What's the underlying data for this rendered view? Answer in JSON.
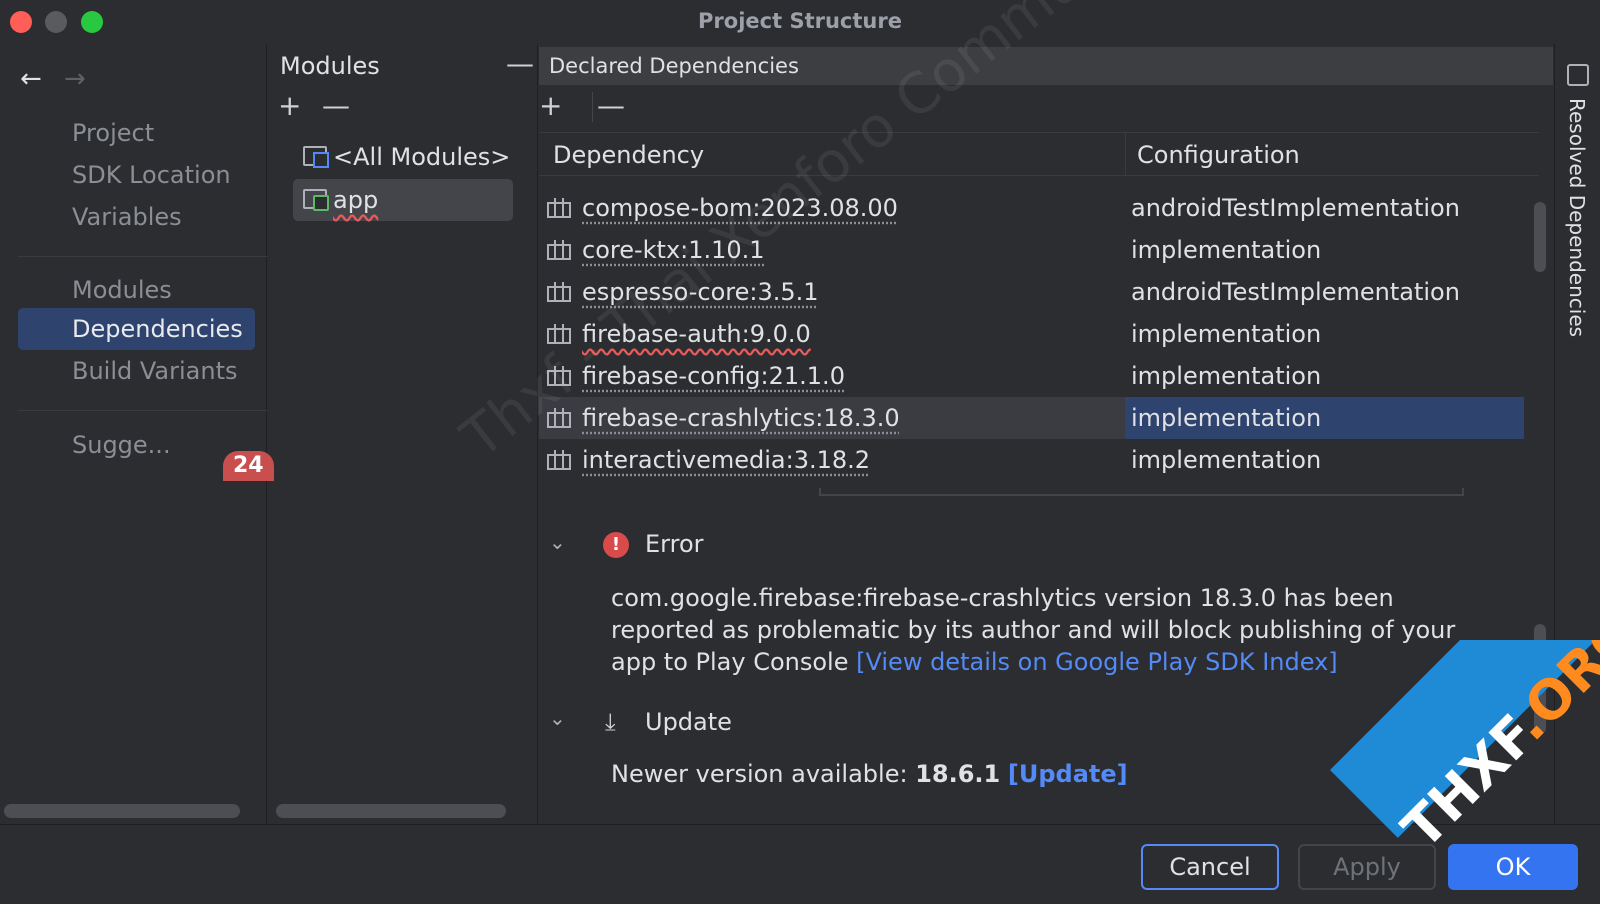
{
  "window": {
    "title": "Project Structure"
  },
  "nav": {
    "back_icon": "←",
    "forward_icon": "→",
    "items": [
      {
        "label": "Project"
      },
      {
        "label": "SDK Location"
      },
      {
        "label": "Variables"
      },
      {
        "label": "Modules"
      },
      {
        "label": "Dependencies",
        "selected": true
      },
      {
        "label": "Build Variants"
      },
      {
        "label": "Sugge..."
      }
    ],
    "suggestions_badge": "24"
  },
  "modules": {
    "title": "Modules",
    "collapse_icon": "—",
    "add_icon": "+",
    "remove_icon": "—",
    "items": [
      {
        "label": "<All Modules>",
        "icon": "all-modules-folder-icon"
      },
      {
        "label": "app",
        "icon": "module-folder-icon",
        "selected": true
      }
    ]
  },
  "declared": {
    "title": "Declared Dependencies",
    "add_icon": "+",
    "remove_icon": "—",
    "columns": {
      "dependency": "Dependency",
      "configuration": "Configuration"
    },
    "rows": [
      {
        "name": "compose-bom:2023.08.00",
        "config": "androidTestImplementation"
      },
      {
        "name": "core-ktx:1.10.1",
        "config": "implementation"
      },
      {
        "name": "espresso-core:3.5.1",
        "config": "androidTestImplementation"
      },
      {
        "name": "firebase-auth:9.0.0",
        "config": "implementation"
      },
      {
        "name": "firebase-config:21.1.0",
        "config": "implementation"
      },
      {
        "name": "firebase-crashlytics:18.3.0",
        "config": "implementation"
      },
      {
        "name": "interactivemedia:3.18.2",
        "config": "implementation"
      }
    ]
  },
  "details": {
    "error": {
      "title": "Error",
      "chevron": "⌄",
      "message": "com.google.firebase:firebase-crashlytics version 18.3.0 has been reported as problematic by its author and will block publishing of your app to Play Console",
      "link": "[View details on Google Play SDK Index]"
    },
    "update": {
      "title": "Update",
      "chevron": "⌄",
      "icon": "⤓",
      "label": "Newer version available:",
      "version": "18.6.1",
      "link": "[Update]"
    }
  },
  "side_panel": {
    "label": "Resolved Dependencies"
  },
  "footer": {
    "cancel": "Cancel",
    "apply": "Apply",
    "ok": "OK"
  },
  "watermark": {
    "text": "Thxf - Thai Xenforo Community",
    "corner": "THXF",
    "corner_suffix": ".ORG"
  },
  "colors": {
    "accent": "#3574f0",
    "selection": "#2e436e",
    "error": "#d94a4a",
    "link": "#548af7"
  }
}
